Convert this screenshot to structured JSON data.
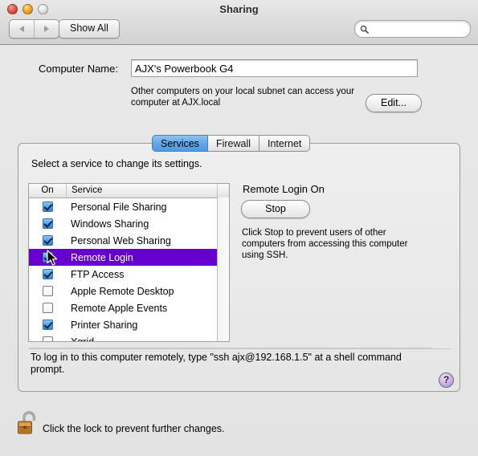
{
  "window": {
    "title": "Sharing",
    "traffic_lights": [
      "close",
      "minimize",
      "zoom"
    ]
  },
  "toolbar": {
    "back_icon": "back-arrow-icon",
    "forward_icon": "forward-arrow-icon",
    "show_all_label": "Show All",
    "search_value": "",
    "search_placeholder": ""
  },
  "computer_name": {
    "label": "Computer Name:",
    "value": "AJX's Powerbook G4",
    "subnet_text": "Other computers on your local subnet can access your computer at AJX.local",
    "edit_label": "Edit..."
  },
  "tabs": [
    {
      "label": "Services",
      "active": true
    },
    {
      "label": "Firewall",
      "active": false
    },
    {
      "label": "Internet",
      "active": false
    }
  ],
  "panel": {
    "instruction": "Select a service to change its settings.",
    "columns": {
      "on": "On",
      "service": "Service"
    },
    "services": [
      {
        "name": "Personal File Sharing",
        "on": true,
        "selected": false
      },
      {
        "name": "Windows Sharing",
        "on": true,
        "selected": false
      },
      {
        "name": "Personal Web Sharing",
        "on": true,
        "selected": false
      },
      {
        "name": "Remote Login",
        "on": true,
        "selected": true
      },
      {
        "name": "FTP Access",
        "on": true,
        "selected": false
      },
      {
        "name": "Apple Remote Desktop",
        "on": false,
        "selected": false
      },
      {
        "name": "Remote Apple Events",
        "on": false,
        "selected": false
      },
      {
        "name": "Printer Sharing",
        "on": true,
        "selected": false
      },
      {
        "name": "Xgrid",
        "on": false,
        "selected": false
      }
    ],
    "detail": {
      "title": "Remote Login On",
      "button_label": "Stop",
      "description": "Click Stop to prevent users of other computers from accessing this computer using SSH."
    },
    "footer_note": "To log in to this computer remotely, type \"ssh ajx@192.168.1.5\" at a shell command prompt.",
    "help_label": "?"
  },
  "lock_bar": {
    "icon": "open-padlock-icon",
    "text": "Click the lock to prevent further changes."
  },
  "colors": {
    "selection": "#6600CC",
    "active_tab": "#4E9AE4",
    "checkbox_on": "#2F84D8",
    "help_purple": "#A98AD2"
  }
}
